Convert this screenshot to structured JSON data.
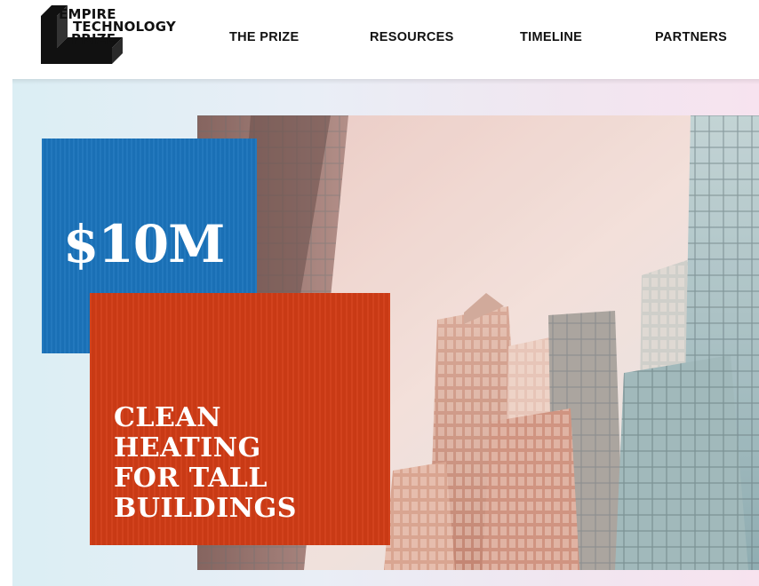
{
  "header": {
    "logo": {
      "line1": "EMPIRE",
      "line2": "TECHNOLOGY",
      "line3": "PRIZE"
    },
    "nav": [
      {
        "label": "THE PRIZE"
      },
      {
        "label": "RESOURCES"
      },
      {
        "label": "TIMELINE"
      },
      {
        "label": "PARTNERS"
      }
    ]
  },
  "hero": {
    "prize_amount": "$10M",
    "tagline": [
      "CLEAN",
      "HEATING",
      "FOR TALL",
      "BUILDINGS"
    ]
  },
  "colors": {
    "prize_blue": "#1b73bb",
    "tagline_red": "#d13c16",
    "text_dark": "#111111",
    "hero_bg_left": "#dbeef4",
    "hero_bg_right": "#f7e3ef"
  },
  "icons": {
    "logo_mark": "empire-technology-prize-logo"
  }
}
